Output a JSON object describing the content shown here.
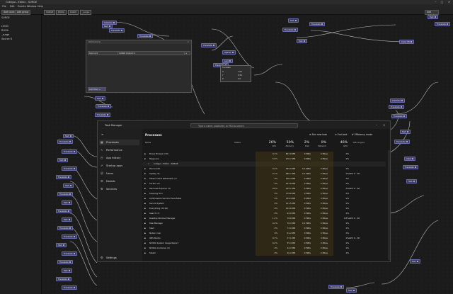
{
  "app": {
    "title": "Cutegui - Editor - SURGE"
  },
  "menu": [
    "File",
    "Edit",
    "Events",
    "Window",
    "Help"
  ],
  "toolbar": {
    "add_source": "Add source",
    "add_group": "Add group",
    "add_global": "Add global"
  },
  "tabs": [
    "SURGE",
    "ROOA",
    "LOGIC",
    "_surge"
  ],
  "sidebar": {
    "header": "SURGE",
    "items": [
      "LOGIC",
      "ROOA",
      "_surge",
      "Source 8"
    ]
  },
  "graph": {
    "node_labels": {
      "translate": "Translate",
      "text": "Text",
      "colorval": "ColorVal",
      "color_fill": "Color Fill",
      "spacer": "Spacer",
      "lerp": "Lerp",
      "color": "Color"
    },
    "panel": {
      "add_source": "Add source",
      "source": "Source 0",
      "output": "CABLE Output 0",
      "add_filter": "Add filter +"
    },
    "vec": {
      "title": "Translate",
      "x": "X",
      "y": "Y",
      "z": "Z",
      "xv": "1.00",
      "yv": "0.50",
      "zv": "0.0"
    }
  },
  "task_manager": {
    "title": "Task Manager",
    "search_placeholder": "Type a name, publisher, or PID to search",
    "nav": [
      {
        "label": "Processes",
        "icon": "grid-icon"
      },
      {
        "label": "Performance",
        "icon": "chart-icon"
      },
      {
        "label": "App history",
        "icon": "clock-icon"
      },
      {
        "label": "Startup apps",
        "icon": "rocket-icon"
      },
      {
        "label": "Users",
        "icon": "users-icon"
      },
      {
        "label": "Details",
        "icon": "list-icon"
      },
      {
        "label": "Services",
        "icon": "gear-icon"
      }
    ],
    "settings": "Settings",
    "header": "Processes",
    "actions": {
      "run_new": "Run new task",
      "end_task": "End task",
      "efficiency": "Efficiency mode"
    },
    "columns": [
      {
        "pct": "",
        "label": "Name"
      },
      {
        "pct": "",
        "label": "Status"
      },
      {
        "pct": "26%",
        "label": "CPU"
      },
      {
        "pct": "50%",
        "label": "Memory"
      },
      {
        "pct": "2%",
        "label": "Disk"
      },
      {
        "pct": "0%",
        "label": "Network"
      },
      {
        "pct": "46%",
        "label": "GPU"
      },
      {
        "pct": "",
        "label": "GPU engine"
      }
    ],
    "rows": [
      {
        "name": "Brave Browser (30)",
        "cpu": "0.1%",
        "mem": "807.0 MB",
        "disk": "0 MB/s",
        "net": "0 Mbps",
        "gpu": "0%",
        "eng": ""
      },
      {
        "name": "Mega.exe",
        "cpu": "5.0%",
        "mem": "270.7 MB",
        "disk": "0 MB/s",
        "net": "0 Mbps",
        "gpu": "0%",
        "eng": ""
      },
      {
        "name": "Cutegui - Editor - SURGE",
        "cpu": "",
        "mem": "",
        "disk": "",
        "net": "",
        "gpu": "",
        "eng": ""
      },
      {
        "name": "Discord (8)",
        "cpu": "0.2%",
        "mem": "355.0 MB",
        "disk": "0.1 MB/s",
        "net": "0 Mbps",
        "gpu": "0%",
        "eng": ""
      },
      {
        "name": "Spotify (5)",
        "cpu": "0.1%",
        "mem": "480.7 MB",
        "disk": "0.1 MB/s",
        "net": "0 Mbps",
        "gpu": "0%",
        "eng": "GPU 0 - 3D"
      },
      {
        "name": "Steam Client WebHelper (7)",
        "cpu": "0%",
        "mem": "306.4 MB",
        "disk": "0 MB/s",
        "net": "0 Mbps",
        "gpu": "0%",
        "eng": ""
      },
      {
        "name": "Surfers (2)",
        "cpu": "0%",
        "mem": "227.8 MB",
        "disk": "0 MB/s",
        "net": "0 Mbps",
        "gpu": "0%",
        "eng": ""
      },
      {
        "name": "Windows Explorer (4)",
        "cpu": "0.8%",
        "mem": "225.1 MB",
        "disk": "0 MB/s",
        "net": "0 Mbps",
        "gpu": "0%",
        "eng": "GPU 0 - 3D"
      },
      {
        "name": "Snipping Tool",
        "cpu": "0%",
        "mem": "179.6 MB",
        "disk": "0 MB/s",
        "net": "0 Mbps",
        "gpu": "0%",
        "eng": ""
      },
      {
        "name": "Antimalware Service Executable",
        "cpu": "0%",
        "mem": "139.4 MB",
        "disk": "0 MB/s",
        "net": "0 Mbps",
        "gpu": "0%",
        "eng": ""
      },
      {
        "name": "Secure System",
        "cpu": "0%",
        "mem": "111.5 MB",
        "disk": "0 MB/s",
        "net": "0 Mbps",
        "gpu": "0%",
        "eng": ""
      },
      {
        "name": "Everything (32 bit)",
        "cpu": "0%",
        "mem": "104.6 MB",
        "disk": "0 MB/s",
        "net": "0 Mbps",
        "gpu": "0%",
        "eng": ""
      },
      {
        "name": "Search (7)",
        "cpu": "0%",
        "mem": "94.9 MB",
        "disk": "0 MB/s",
        "net": "0 Mbps",
        "gpu": "0%",
        "eng": ""
      },
      {
        "name": "Desktop Window Manager",
        "cpu": "1.1%",
        "mem": "78.6 MB",
        "disk": "0 MB/s",
        "net": "0 Mbps",
        "gpu": "0.8%",
        "eng": "GPU 0 - 3D"
      },
      {
        "name": "Task Manager",
        "cpu": "2.2%",
        "mem": "76.4 MB",
        "disk": "0.1 MB/s",
        "net": "0 Mbps",
        "gpu": "0%",
        "eng": ""
      },
      {
        "name": "Start",
        "cpu": "0%",
        "mem": "73.2 MB",
        "disk": "0 MB/s",
        "net": "0 Mbps",
        "gpu": "0%",
        "eng": ""
      },
      {
        "name": "Notion (nw)",
        "cpu": "0%",
        "mem": "61.2 MB",
        "disk": "0 MB/s",
        "net": "0 Mbps",
        "gpu": "0%",
        "eng": ""
      },
      {
        "name": "OBS Studio",
        "cpu": "0.7%",
        "mem": "37.1 MB",
        "disk": "0 MB/s",
        "net": "0 Mbps",
        "gpu": "0%",
        "eng": "GPU 0 - 3D"
      },
      {
        "name": "NVIDIA System Usage Report",
        "cpu": "0.2%",
        "mem": "35.4 MB",
        "disk": "0 MB/s",
        "net": "0 Mbps",
        "gpu": "0%",
        "eng": ""
      },
      {
        "name": "NVIDIA Container (2)",
        "cpu": "0%",
        "mem": "42.2 MB",
        "disk": "0 MB/s",
        "net": "0 Mbps",
        "gpu": "0%",
        "eng": ""
      },
      {
        "name": "Steam",
        "cpu": "0%",
        "mem": "30.2 MB",
        "disk": "0 MB/s",
        "net": "0 Mbps",
        "gpu": "0%",
        "eng": ""
      }
    ]
  },
  "colors": {
    "accent": "#6b6bb0",
    "node": "#3b3b5a",
    "heat": "#4a3a1a"
  }
}
